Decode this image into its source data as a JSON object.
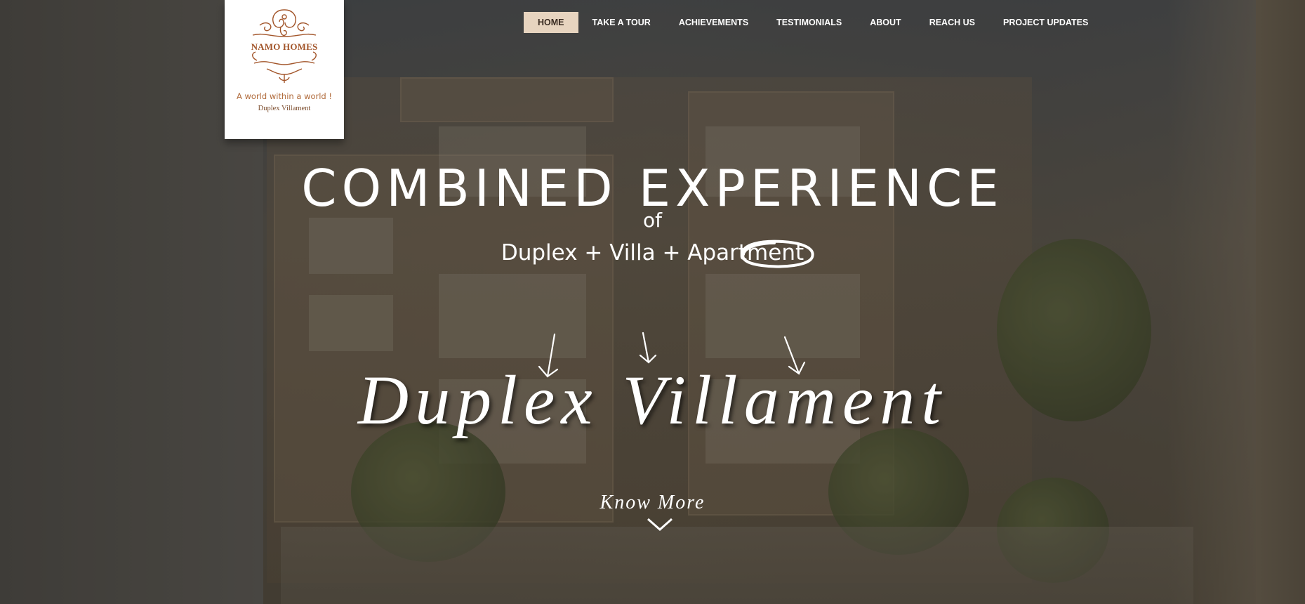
{
  "logo": {
    "brand": "NAMO HOMES",
    "tagline": "A world within a world !",
    "subtitle": "Duplex Villament"
  },
  "nav": {
    "items": [
      {
        "label": "HOME",
        "active": true
      },
      {
        "label": "TAKE A TOUR",
        "active": false
      },
      {
        "label": "ACHIEVEMENTS",
        "active": false
      },
      {
        "label": "TESTIMONIALS",
        "active": false
      },
      {
        "label": "ABOUT",
        "active": false
      },
      {
        "label": "REACH US",
        "active": false
      },
      {
        "label": "PROJECT UPDATES",
        "active": false
      }
    ]
  },
  "hero": {
    "title": "COMBINED EXPERIENCE",
    "of": "of",
    "subtitle": "Duplex + Villa + Apartment",
    "script": "Duplex Villament",
    "cta": "Know More",
    "cta_icon": "chevron-down-icon"
  },
  "colors": {
    "nav_active_bg": "#e7d4bf",
    "logo_brown": "#a2552a",
    "text_white": "#ffffff"
  }
}
